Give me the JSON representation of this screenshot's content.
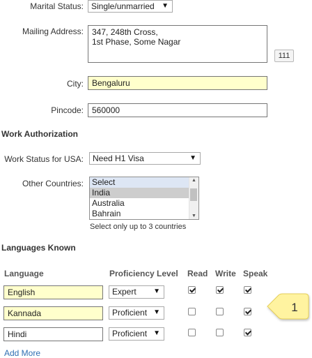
{
  "personal": {
    "marital_label": "Marital Status:",
    "marital_value": "Single/unmarried",
    "address_label": "Mailing Address:",
    "address_line1": "347, 248th Cross,",
    "address_line2": "1st Phase, Some Nagar",
    "address_counter": "111",
    "city_label": "City:",
    "city_value": "Bengaluru",
    "pincode_label": "Pincode:",
    "pincode_value": "560000"
  },
  "work_auth": {
    "heading": "Work Authorization",
    "status_label": "Work Status for USA:",
    "status_value": "Need H1 Visa",
    "other_label": "Other Countries:",
    "options": [
      "Select",
      "India",
      "Australia",
      "Bahrain"
    ],
    "hint": "Select only up to 3 countries"
  },
  "languages": {
    "heading": "Languages Known",
    "col_language": "Language",
    "col_proficiency": "Proficiency Level",
    "col_read": "Read",
    "col_write": "Write",
    "col_speak": "Speak",
    "rows": [
      {
        "language": "English",
        "proficiency": "Expert",
        "read": true,
        "write": true,
        "speak": true
      },
      {
        "language": "Kannada",
        "proficiency": "Proficient",
        "read": false,
        "write": false,
        "speak": true
      },
      {
        "language": "Hindi",
        "proficiency": "Proficient",
        "read": false,
        "write": false,
        "speak": true
      }
    ],
    "add_more": "Add More"
  },
  "callout": {
    "number": "1",
    "color": "#fff3a0"
  },
  "colors": {
    "highlight": "#ffffcc",
    "link": "#2f6fb3",
    "list_selected": "#dde6f4"
  }
}
